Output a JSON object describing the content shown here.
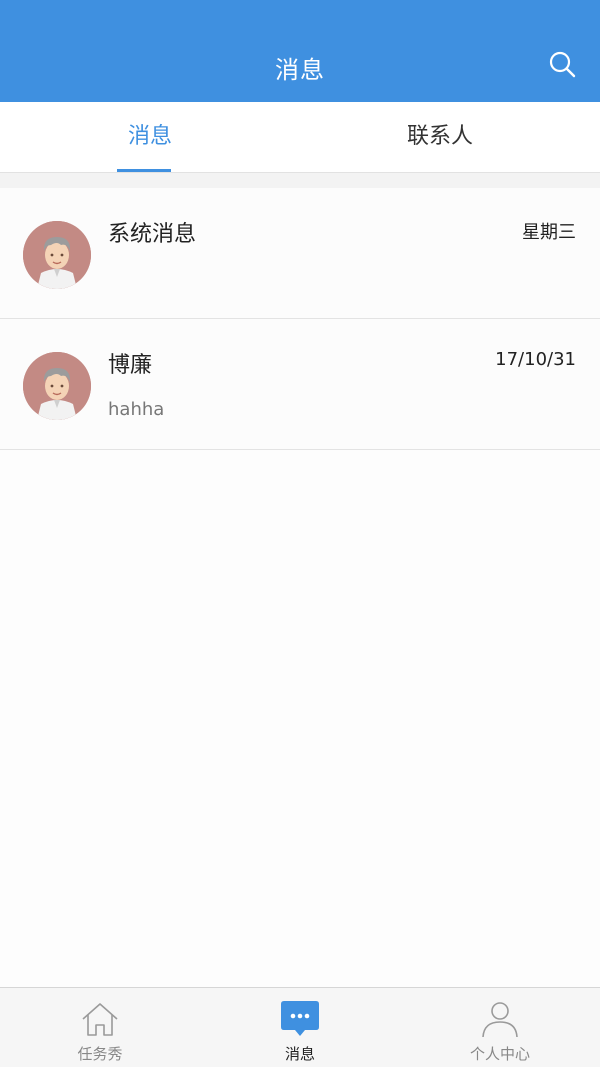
{
  "header": {
    "title": "消息",
    "search_icon": "search-icon",
    "background": "#3f90e0"
  },
  "tabs": [
    {
      "label": "消息",
      "active": true
    },
    {
      "label": "联系人",
      "active": false
    }
  ],
  "conversations": [
    {
      "name": "系统消息",
      "time": "星期三",
      "preview": "",
      "avatar": "avatar-icon"
    },
    {
      "name": "博廉",
      "time": "17/10/31",
      "preview": "hahha",
      "avatar": "avatar-icon"
    }
  ],
  "bottom_nav": [
    {
      "label": "任务秀",
      "icon": "home-icon",
      "active": false
    },
    {
      "label": "消息",
      "icon": "message-icon",
      "active": true
    },
    {
      "label": "个人中心",
      "icon": "person-icon",
      "active": false
    }
  ],
  "accent_color": "#3f90e0"
}
